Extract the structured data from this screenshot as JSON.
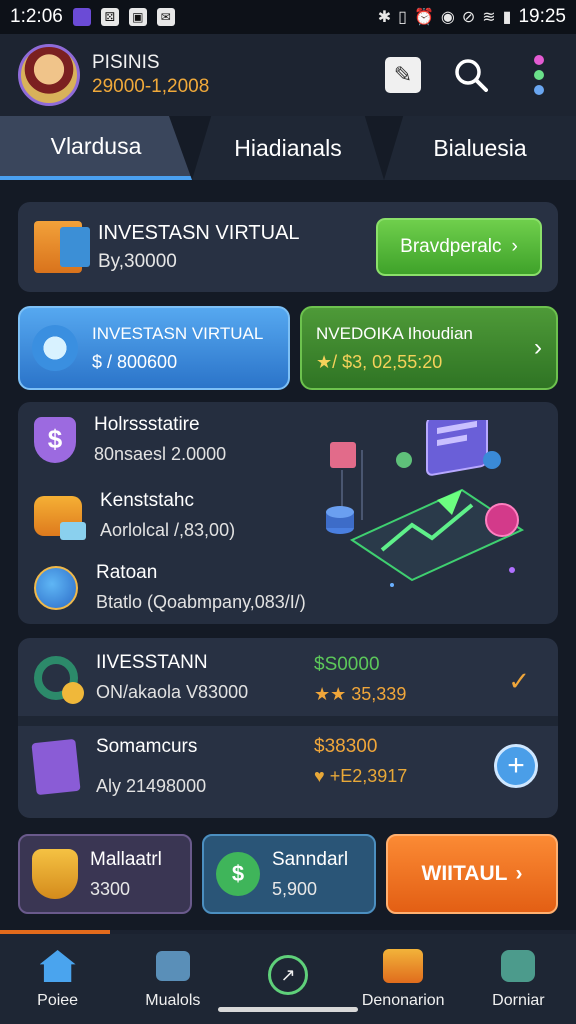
{
  "status_bar": {
    "time_left": "1:2:06",
    "time_right": "19:25"
  },
  "header": {
    "name": "PISINIS",
    "coins": "29000-1,2008"
  },
  "tabs": [
    {
      "label": "Vlardusa",
      "active": true
    },
    {
      "label": "Hiadianals",
      "active": false
    },
    {
      "label": "Bialuesia",
      "active": false
    }
  ],
  "card1": {
    "title": "INVESTASN VIRTUAL",
    "subtitle": "By,30000",
    "button": "Bravdperalc"
  },
  "card2a": {
    "title": "INVESTASN VIRTUAL",
    "value": "$ / 800600"
  },
  "card2b": {
    "title": "NVEDOIKA Ihoudian",
    "value": "★/ $3, 02,55:20"
  },
  "card3": {
    "rows": [
      {
        "title": "Holrssstatire",
        "sub": "80nsaesl 2.0000"
      },
      {
        "title": "Kenststahc",
        "sub": "Aorlolcal /,83,00)"
      },
      {
        "title": "Ratoan",
        "sub": "Btatlo (Qoabmpany,083/I/)"
      }
    ]
  },
  "card4": {
    "rows": [
      {
        "title": "IIVESSTANN",
        "sub": "ON/akaola V83000",
        "value": "$S0000",
        "value2": "★★ 35,339"
      },
      {
        "title": "Somamcurs",
        "sub": "Aly 21498000",
        "value": "$38300",
        "value2": "♥ +E2,3917"
      }
    ]
  },
  "tiles": [
    {
      "title": "Mallaatrl",
      "sub": "3300"
    },
    {
      "title": "Sanndarl",
      "sub": "5,900"
    },
    {
      "title": "WIITAUL"
    }
  ],
  "nav": [
    {
      "label": "Poiee"
    },
    {
      "label": "Mualols"
    },
    {
      "label": ""
    },
    {
      "label": "Denonarion"
    },
    {
      "label": "Dorniar"
    }
  ],
  "colors": {
    "accent_blue": "#4aa0f0",
    "accent_green": "#4fae35",
    "accent_orange": "#f0a63a"
  }
}
